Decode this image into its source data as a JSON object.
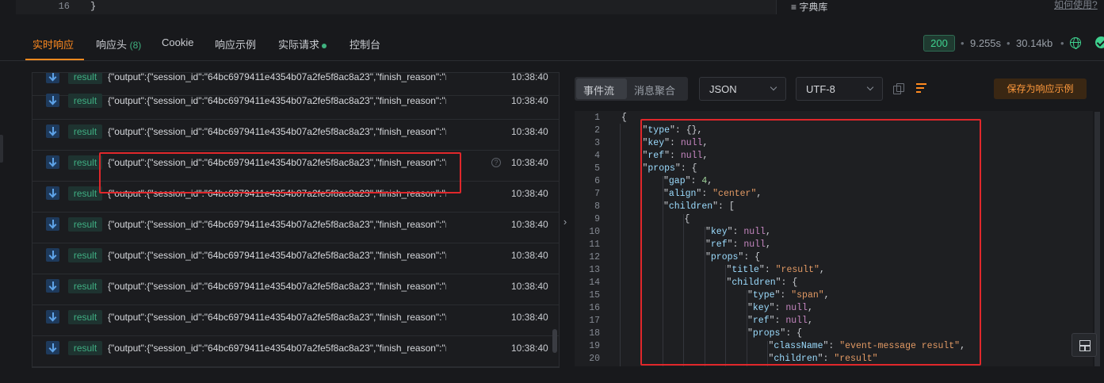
{
  "top": {
    "line_number": "16",
    "line_text": "}",
    "dict_label": "≡ 字典库",
    "howto_link": "如何使用?"
  },
  "tabs": {
    "realtime": "实时响应",
    "headers": "响应头",
    "headers_count": "(8)",
    "cookie": "Cookie",
    "example": "响应示例",
    "actual": "实际请求",
    "console": "控制台"
  },
  "status": {
    "code": "200",
    "time": "9.255s",
    "size": "30.14kb",
    "sep": "•"
  },
  "events": [
    {
      "tag": "result",
      "data": "{\"output\":{\"session_id\":\"64bc6979411e4354b07a2fe5f8ac8a23\",\"finish_reason\":\"null\"",
      "time": "10:38:40"
    },
    {
      "tag": "result",
      "data": "{\"output\":{\"session_id\":\"64bc6979411e4354b07a2fe5f8ac8a23\",\"finish_reason\":\"null\"",
      "time": "10:38:40"
    },
    {
      "tag": "result",
      "data": "{\"output\":{\"session_id\":\"64bc6979411e4354b07a2fe5f8ac8a23\",\"finish_reason\":\"null\"",
      "time": "10:38:40"
    },
    {
      "tag": "result",
      "data": "{\"output\":{\"session_id\":\"64bc6979411e4354b07a2fe5f8ac8a23\",\"finish_reason\":\"null\"",
      "time": "10:38:40"
    },
    {
      "tag": "result",
      "data": "{\"output\":{\"session_id\":\"64bc6979411e4354b07a2fe5f8ac8a23\",\"finish_reason\":\"null\"",
      "time": "10:38:40"
    },
    {
      "tag": "result",
      "data": "{\"output\":{\"session_id\":\"64bc6979411e4354b07a2fe5f8ac8a23\",\"finish_reason\":\"null\"",
      "time": "10:38:40"
    },
    {
      "tag": "result",
      "data": "{\"output\":{\"session_id\":\"64bc6979411e4354b07a2fe5f8ac8a23\",\"finish_reason\":\"null\"",
      "time": "10:38:40"
    },
    {
      "tag": "result",
      "data": "{\"output\":{\"session_id\":\"64bc6979411e4354b07a2fe5f8ac8a23\",\"finish_reason\":\"null\"",
      "time": "10:38:40"
    },
    {
      "tag": "result",
      "data": "{\"output\":{\"session_id\":\"64bc6979411e4354b07a2fe5f8ac8a23\",\"finish_reason\":\"null\"",
      "time": "10:38:40"
    },
    {
      "tag": "result",
      "data": "{\"output\":{\"session_id\":\"64bc6979411e4354b07a2fe5f8ac8a23\",\"finish_reason\":\"null\"",
      "time": "10:38:40"
    }
  ],
  "help_glyph": "?",
  "collapse_glyph": "›",
  "viewer": {
    "mode_stream": "事件流",
    "mode_merge": "消息聚合",
    "format": "JSON",
    "encoding": "UTF-8",
    "save_button": "保存为响应示例"
  },
  "code_lines": [
    {
      "n": "1",
      "i": 0,
      "k": "",
      "v": "",
      "vt": "",
      "t": "{"
    },
    {
      "n": "2",
      "i": 1,
      "k": "type",
      "v": "{}",
      "vt": "p",
      "t": ","
    },
    {
      "n": "3",
      "i": 1,
      "k": "key",
      "v": "null",
      "vt": "kw",
      "t": ","
    },
    {
      "n": "4",
      "i": 1,
      "k": "ref",
      "v": "null",
      "vt": "kw",
      "t": ","
    },
    {
      "n": "5",
      "i": 1,
      "k": "props",
      "v": "{",
      "vt": "p",
      "t": ""
    },
    {
      "n": "6",
      "i": 2,
      "k": "gap",
      "v": "4",
      "vt": "n",
      "t": ","
    },
    {
      "n": "7",
      "i": 2,
      "k": "align",
      "v": "\"center\"",
      "vt": "s",
      "t": ","
    },
    {
      "n": "8",
      "i": 2,
      "k": "children",
      "v": "[",
      "vt": "p",
      "t": ""
    },
    {
      "n": "9",
      "i": 3,
      "k": "",
      "v": "",
      "vt": "",
      "t": "{"
    },
    {
      "n": "10",
      "i": 4,
      "k": "key",
      "v": "null",
      "vt": "kw",
      "t": ","
    },
    {
      "n": "11",
      "i": 4,
      "k": "ref",
      "v": "null",
      "vt": "kw",
      "t": ","
    },
    {
      "n": "12",
      "i": 4,
      "k": "props",
      "v": "{",
      "vt": "p",
      "t": ""
    },
    {
      "n": "13",
      "i": 5,
      "k": "title",
      "v": "\"result\"",
      "vt": "s",
      "t": ","
    },
    {
      "n": "14",
      "i": 5,
      "k": "children",
      "v": "{",
      "vt": "p",
      "t": ""
    },
    {
      "n": "15",
      "i": 6,
      "k": "type",
      "v": "\"span\"",
      "vt": "s",
      "t": ","
    },
    {
      "n": "16",
      "i": 6,
      "k": "key",
      "v": "null",
      "vt": "kw",
      "t": ","
    },
    {
      "n": "17",
      "i": 6,
      "k": "ref",
      "v": "null",
      "vt": "kw",
      "t": ","
    },
    {
      "n": "18",
      "i": 6,
      "k": "props",
      "v": "{",
      "vt": "p",
      "t": ""
    },
    {
      "n": "19",
      "i": 7,
      "k": "className",
      "v": "\"event-message result\"",
      "vt": "s",
      "t": ","
    },
    {
      "n": "20",
      "i": 7,
      "k": "children",
      "v": "\"result\"",
      "vt": "s",
      "t": ""
    }
  ],
  "colors": {
    "accent": "#ff8a1f",
    "success": "#3fd18f",
    "annotation": "#e0272b"
  }
}
